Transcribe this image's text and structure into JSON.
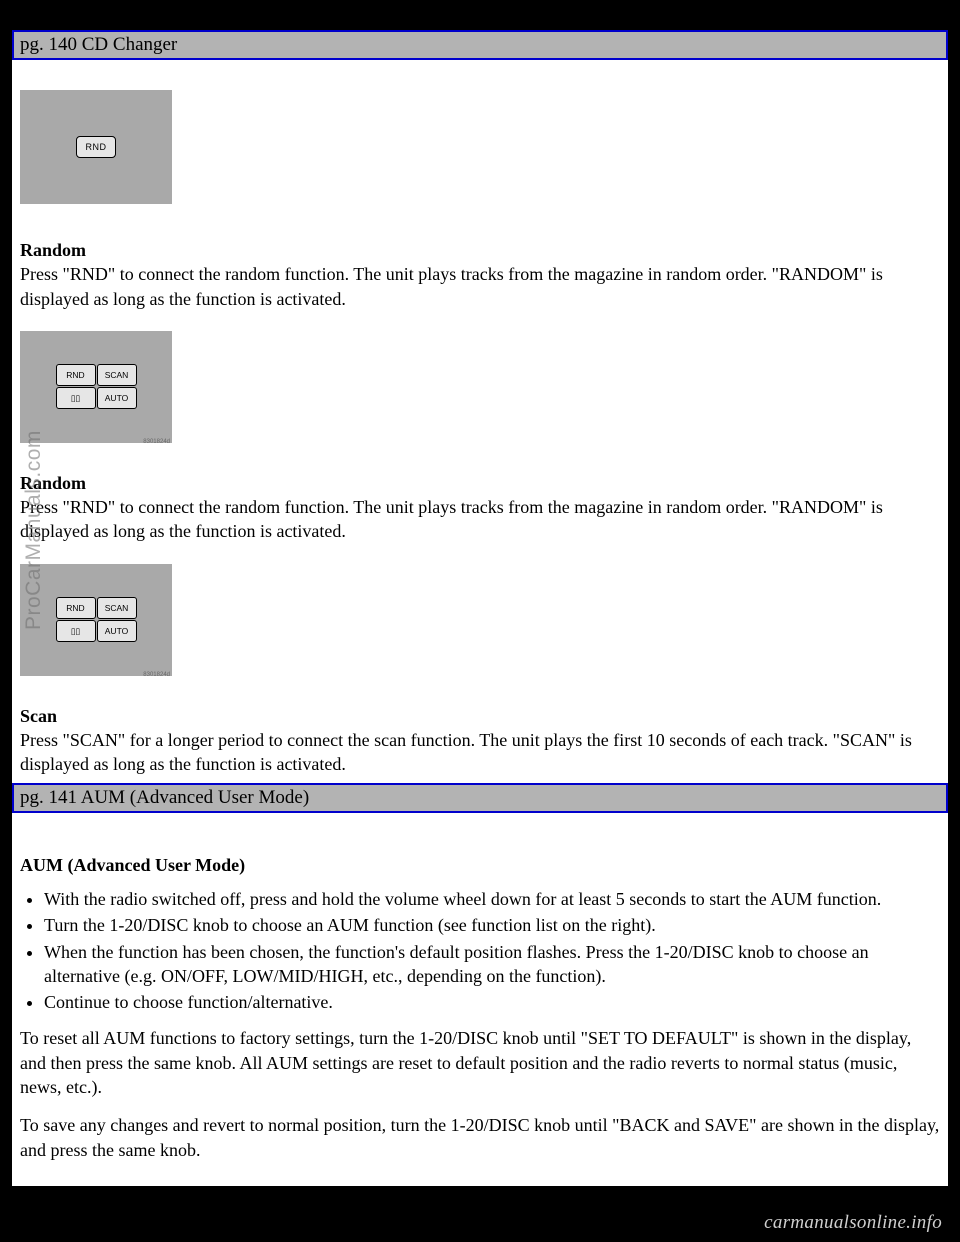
{
  "headers": {
    "h140": "pg. 140 CD Changer",
    "h141": "pg. 141 AUM (Advanced User Mode)"
  },
  "buttons": {
    "rnd": "RND",
    "scan": "SCAN",
    "dolby": "▯▯",
    "auto": "AUTO"
  },
  "sections": {
    "random1": {
      "title": "Random",
      "body": "Press \"RND\" to connect the random function. The unit plays tracks from the magazine in random order. \"RANDOM\" is displayed as long as the function is activated."
    },
    "random2": {
      "title": "Random",
      "body": "Press \"RND\" to connect the random function. The unit plays tracks from the magazine in random order. \"RANDOM\" is displayed as long as the function is activated."
    },
    "scan": {
      "title": "Scan",
      "body": "Press \"SCAN\" for a longer period to connect the scan function. The unit plays the first 10 seconds of each track. \"SCAN\" is displayed as long as the function is activated."
    },
    "aum": {
      "title": "AUM (Advanced User Mode)",
      "bullets": [
        "With the radio switched off, press and hold the volume wheel down for at least 5 seconds to start the AUM function.",
        "Turn the 1-20/DISC knob to choose an AUM function (see function list on the right).",
        "When the function has been chosen, the function's default position flashes. Press the 1-20/DISC knob to choose an alternative (e.g. ON/OFF, LOW/MID/HIGH, etc., depending on the function).",
        "Continue to choose function/alternative."
      ],
      "reset": "To reset all AUM functions to factory settings, turn the 1-20/DISC knob until \"SET TO DEFAULT\" is shown in the display, and then press the same knob. All AUM settings are reset to default position and the radio reverts to normal status (music, news, etc.).",
      "save": "To save any changes and revert to normal position, turn the 1-20/DISC knob until \"BACK and SAVE\" are shown in the display, and press the same knob."
    }
  },
  "watermarks": {
    "side": "ProCarManuals.com",
    "footer": "carmanualsonline.info"
  }
}
